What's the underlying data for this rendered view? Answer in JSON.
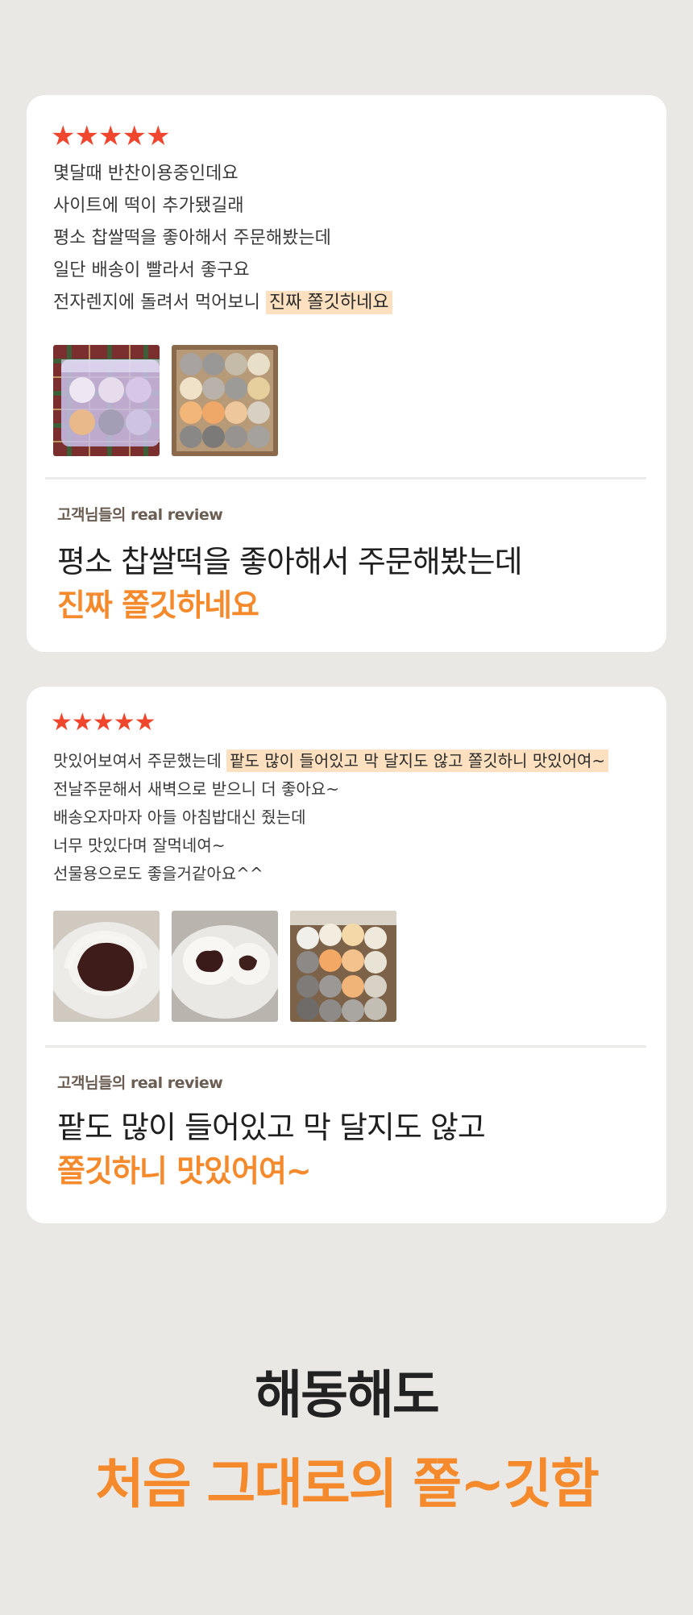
{
  "reviews": [
    {
      "rating": 5,
      "lines": [
        {
          "text": "몇달때 반찬이용중인데요"
        },
        {
          "text": "사이트에 떡이 추가됐길래"
        },
        {
          "text": "평소 찹쌀떡을 좋아해서 주문해봤는데"
        },
        {
          "text": "일단 배송이 빨라서 좋구요"
        },
        {
          "text": "전자렌지에 돌려서 먹어보니 ",
          "highlight": "진짜 쫄깃하네요"
        }
      ],
      "photo_icons": [
        "rice-cake-package-photo",
        "rice-cake-box-photo"
      ],
      "caption_label": "고객님들의 real review",
      "quote_line1": "평소 찹쌀떡을 좋아해서 주문해봤는데",
      "quote_line2": "진짜 쫄깃하네요"
    },
    {
      "rating": 5,
      "lines": [
        {
          "text": "맛있어보여서 주문했는데 ",
          "highlight": "팥도 많이 들어있고 막 달지도 않고 쫄깃하니 맛있어여~"
        },
        {
          "text": "전날주문해서 새벽으로 받으니 더 좋아요~"
        },
        {
          "text": "배송오자마자 아들 아침밥대신 줬는데"
        },
        {
          "text": "너무 맛있다며 잘먹네여~"
        },
        {
          "text": "선물용으로도 좋을거같아요^^"
        }
      ],
      "photo_icons": [
        "rice-cake-cut-photo",
        "rice-cake-bite-photo",
        "rice-cake-box-photo"
      ],
      "caption_label": "고객님들의 real review",
      "quote_line1": "팥도 많이 들어있고 막 달지도 않고",
      "quote_line2": "쫄깃하니 맛있어여~"
    }
  ],
  "footer": {
    "title": "해동해도",
    "subtitle": "처음 그대로의 쫄~깃함"
  },
  "colors": {
    "background": "#eae8e4",
    "star": "#f0462d",
    "accent_orange": "#f58a2c",
    "highlight": "#fde0bf"
  }
}
